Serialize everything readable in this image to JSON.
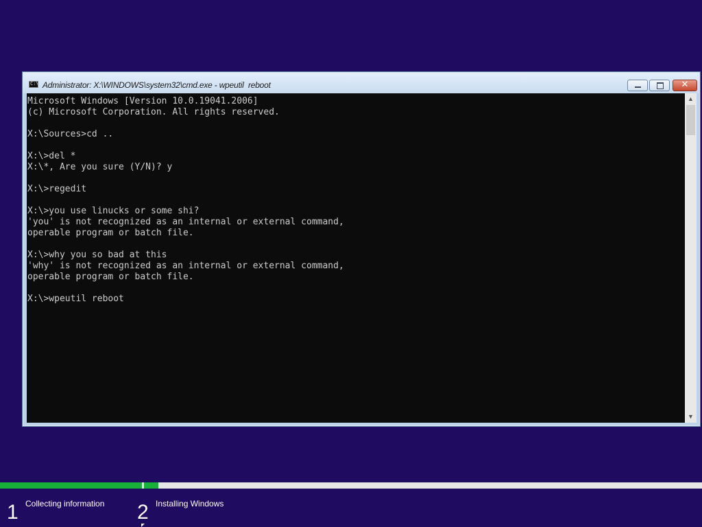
{
  "window": {
    "title": "Administrator: X:\\WINDOWS\\system32\\cmd.exe - wpeutil  reboot",
    "icon_label": "C:\\",
    "icon": "cmd-icon",
    "controls": {
      "minimize_icon": "minimize-icon",
      "maximize_icon": "maximize-icon",
      "close_icon": "close-icon",
      "close_glyph": "✕"
    }
  },
  "console": {
    "lines": [
      "Microsoft Windows [Version 10.0.19041.2006]",
      "(c) Microsoft Corporation. All rights reserved.",
      "",
      "X:\\Sources>cd ..",
      "",
      "X:\\>del *",
      "X:\\*, Are you sure (Y/N)? y",
      "",
      "X:\\>regedit",
      "",
      "X:\\>you use linucks or some shi?",
      "'you' is not recognized as an internal or external command,",
      "operable program or batch file.",
      "",
      "X:\\>why you so bad at this",
      "'why' is not recognized as an internal or external command,",
      "operable program or batch file.",
      "",
      "X:\\>wpeutil reboot"
    ]
  },
  "scrollbar": {
    "up_glyph": "▲",
    "down_glyph": "▼"
  },
  "setup": {
    "steps": [
      {
        "number": "1",
        "label": "Collecting information"
      },
      {
        "number": "2",
        "label": "Installing Windows"
      }
    ],
    "progress_color": "#17b13a"
  },
  "colors": {
    "background": "#1f0b5f",
    "console_bg": "#0c0c0c",
    "console_fg": "#cccccc"
  }
}
